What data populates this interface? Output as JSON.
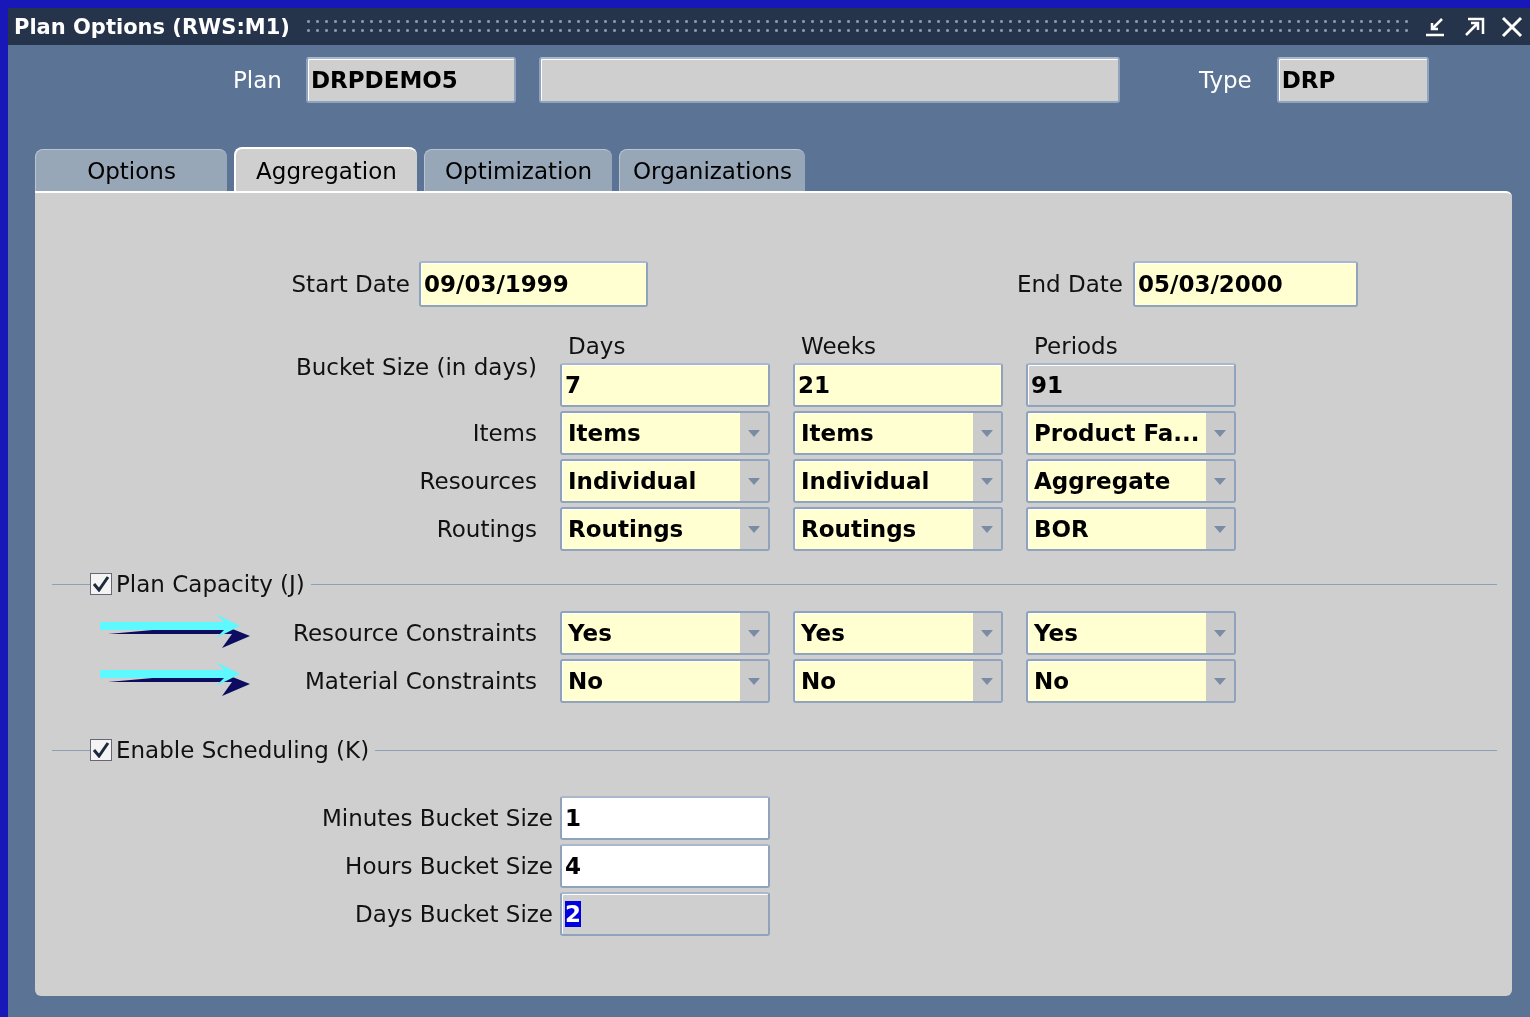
{
  "window": {
    "title": "Plan Options (RWS:M1)"
  },
  "header": {
    "plan_label": "Plan",
    "plan_value": "DRPDEMO5",
    "type_label": "Type",
    "type_value": "DRP"
  },
  "tabs": [
    {
      "label": "Options",
      "selected": false
    },
    {
      "label": "Aggregation",
      "selected": true
    },
    {
      "label": "Optimization",
      "selected": false
    },
    {
      "label": "Organizations",
      "selected": false
    }
  ],
  "dates": [
    {
      "label": "Start Date",
      "value": "09/03/1999"
    },
    {
      "label": "End Date",
      "value": "05/03/2000"
    }
  ],
  "bucket_size": {
    "label": "Bucket Size (in days)",
    "columns": [
      {
        "heading": "Days",
        "value": "7",
        "disabled": false
      },
      {
        "heading": "Weeks",
        "value": "21",
        "disabled": false
      },
      {
        "heading": "Periods",
        "value": "91",
        "disabled": true
      }
    ]
  },
  "aggregation_rows": [
    {
      "label": "Items",
      "values": [
        "Items",
        "Items",
        "Product Fa..."
      ]
    },
    {
      "label": "Resources",
      "values": [
        "Individual",
        "Individual",
        "Aggregate"
      ]
    },
    {
      "label": "Routings",
      "values": [
        "Routings",
        "Routings",
        "BOR"
      ]
    }
  ],
  "plan_capacity": {
    "label": "Plan Capacity  (J)",
    "checked": true,
    "rows": [
      {
        "label": "Resource Constraints",
        "values": [
          "Yes",
          "Yes",
          "Yes"
        ]
      },
      {
        "label": "Material Constraints",
        "values": [
          "No",
          "No",
          "No"
        ]
      }
    ]
  },
  "enable_scheduling": {
    "label": "Enable Scheduling (K)",
    "checked": true,
    "rows": [
      {
        "label": "Minutes Bucket Size",
        "value": "1",
        "disabled": false,
        "text_selected": false
      },
      {
        "label": "Hours Bucket Size",
        "value": "4",
        "disabled": false,
        "text_selected": false
      },
      {
        "label": "Days Bucket Size",
        "value": "2",
        "disabled": true,
        "text_selected": true
      }
    ]
  }
}
